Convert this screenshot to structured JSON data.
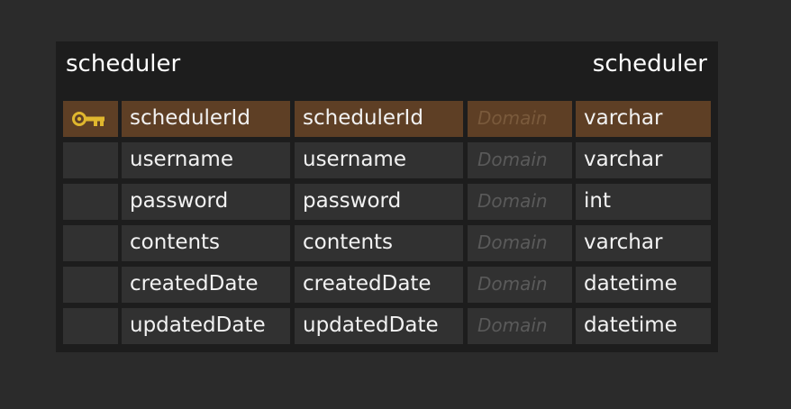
{
  "entity": {
    "logical_name": "scheduler",
    "physical_name": "scheduler",
    "colors": {
      "background": "#2b2b2b",
      "entity_fill": "#1d1d1d",
      "cell_fill": "#313131",
      "primary_key_fill": "#5e3f25",
      "key_icon": "#e0b72e",
      "text": "#f2f2f2",
      "domain_text": "#5a5a5a"
    },
    "columns": [
      {
        "key_icon": "key-icon",
        "logical": "schedulerId",
        "physical": "schedulerId",
        "domain": "Domain",
        "type": "varchar"
      },
      {
        "logical": "username",
        "physical": "username",
        "domain": "Domain",
        "type": "varchar"
      },
      {
        "logical": "password",
        "physical": "password",
        "domain": "Domain",
        "type": "int"
      },
      {
        "logical": "contents",
        "physical": "contents",
        "domain": "Domain",
        "type": "varchar"
      },
      {
        "logical": "createdDate",
        "physical": "createdDate",
        "domain": "Domain",
        "type": "datetime"
      },
      {
        "logical": "updatedDate",
        "physical": "updatedDate",
        "domain": "Domain",
        "type": "datetime"
      }
    ]
  }
}
